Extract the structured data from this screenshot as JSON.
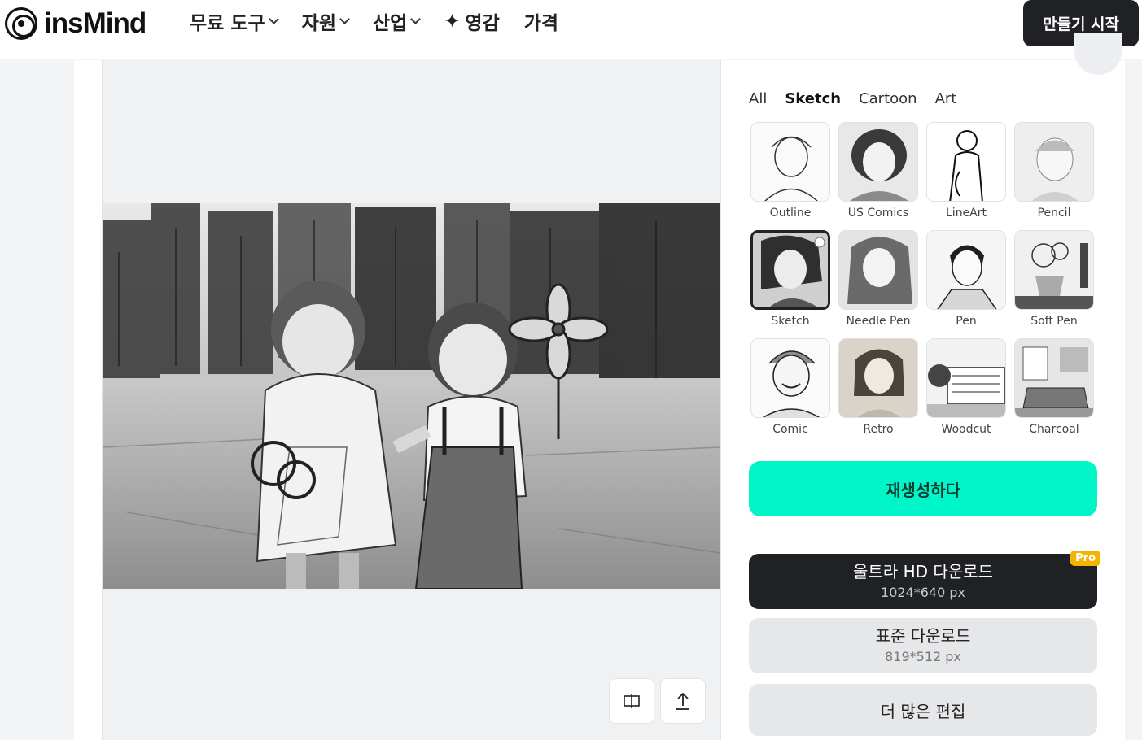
{
  "header": {
    "logo_text": "insMind",
    "nav": [
      {
        "label": "무료 도구",
        "has_dropdown": true
      },
      {
        "label": "자원",
        "has_dropdown": true
      },
      {
        "label": "산업",
        "has_dropdown": true
      },
      {
        "label": "영감",
        "has_dropdown": false,
        "icon": "sparkle-icon"
      },
      {
        "label": "가격",
        "has_dropdown": false
      }
    ],
    "start_button": "만들기 시작"
  },
  "style_tabs": {
    "items": [
      "All",
      "Sketch",
      "Cartoon",
      "Art"
    ],
    "active": "Sketch"
  },
  "styles": [
    {
      "label": "Outline",
      "selected": false
    },
    {
      "label": "US Comics",
      "selected": false
    },
    {
      "label": "LineArt",
      "selected": false
    },
    {
      "label": "Pencil",
      "selected": false
    },
    {
      "label": "Sketch",
      "selected": true
    },
    {
      "label": "Needle Pen",
      "selected": false
    },
    {
      "label": "Pen",
      "selected": false
    },
    {
      "label": "Soft Pen",
      "selected": false
    },
    {
      "label": "Comic",
      "selected": false
    },
    {
      "label": "Retro",
      "selected": false
    },
    {
      "label": "Woodcut",
      "selected": false
    },
    {
      "label": "Charcoal",
      "selected": false
    }
  ],
  "actions": {
    "regenerate": "재생성하다",
    "ultra_hd": {
      "title": "울트라 HD 다운로드",
      "size": "1024*640 px",
      "badge": "Pro"
    },
    "standard": {
      "title": "표준 다운로드",
      "size": "819*512 px"
    },
    "more_edit": "더 많은 편집"
  },
  "colors": {
    "accent": "#00f5c8",
    "dark": "#1f2125",
    "pro_badge": "#f5b400"
  }
}
